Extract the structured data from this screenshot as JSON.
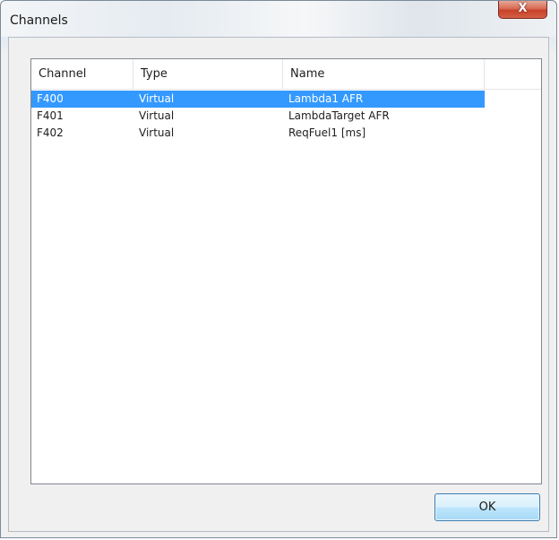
{
  "window": {
    "title": "Channels",
    "close_label": "X"
  },
  "table": {
    "columns": [
      "Channel",
      "Type",
      "Name"
    ],
    "rows": [
      {
        "channel": "F400",
        "type": "Virtual",
        "name": "Lambda1 AFR",
        "selected": true
      },
      {
        "channel": "F401",
        "type": "Virtual",
        "name": "LambdaTarget AFR",
        "selected": false
      },
      {
        "channel": "F402",
        "type": "Virtual",
        "name": "ReqFuel1 [ms]",
        "selected": false
      }
    ]
  },
  "buttons": {
    "ok_label": "OK"
  },
  "colors": {
    "selection": "#3399ff",
    "close_button": "#c7422a"
  },
  "icons": {
    "close": "close-icon"
  }
}
